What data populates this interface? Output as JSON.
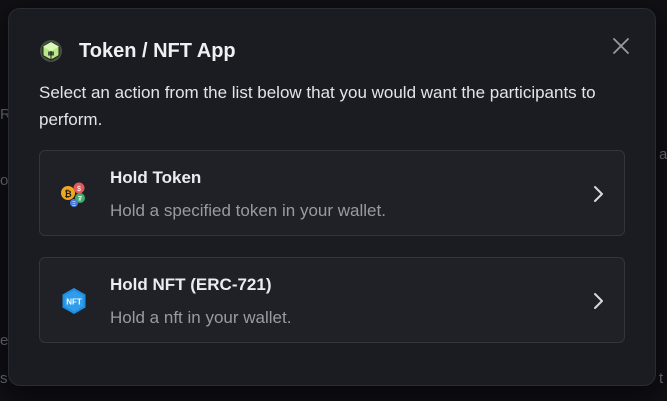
{
  "background": {
    "fragments": [
      "Rl",
      "",
      "o",
      "e",
      "s",
      "a",
      "t"
    ]
  },
  "modal": {
    "title": "Token / NFT App",
    "app_icon": "cube-icon",
    "close_icon": "close-icon",
    "description": "Select an action from the list below that you would want the participants to perform.",
    "options": [
      {
        "title": "Hold Token",
        "subtitle": "Hold a specified token in your wallet.",
        "icon": "coins-icon"
      },
      {
        "title": "Hold NFT (ERC-721)",
        "subtitle": "Hold a nft in your wallet.",
        "icon": "nft-hexagon-icon",
        "icon_label": "NFT"
      }
    ]
  },
  "colors": {
    "modal_bg": "#1b1b22",
    "card_bg": "#202027",
    "accent_green": "#b8e986",
    "nft_blue": "#1e8fe0"
  }
}
